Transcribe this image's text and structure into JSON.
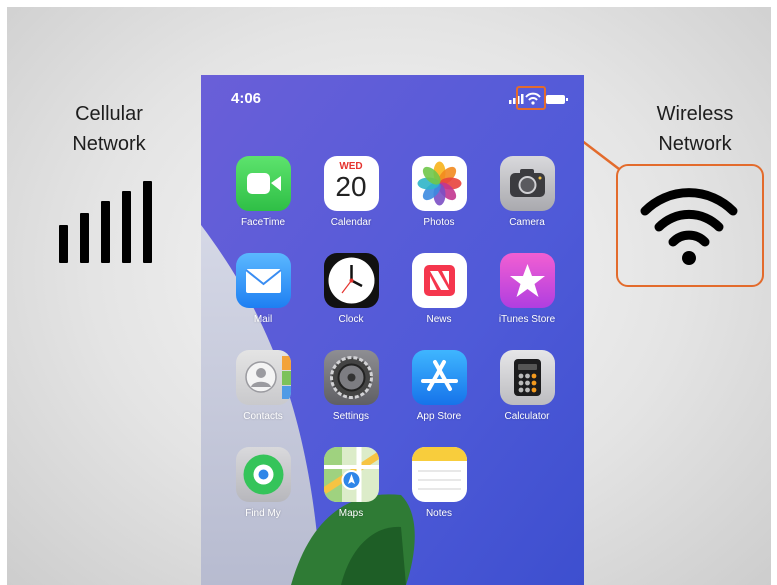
{
  "labels": {
    "cellular_line1": "Cellular",
    "cellular_line2": "Network",
    "wireless_line1": "Wireless",
    "wireless_line2": "Network"
  },
  "status_bar": {
    "time": "4:06"
  },
  "apps": [
    {
      "name": "FaceTime",
      "icon": "facetime-icon"
    },
    {
      "name": "Calendar",
      "icon": "calendar-icon",
      "day": "WED",
      "date": "20"
    },
    {
      "name": "Photos",
      "icon": "photos-icon"
    },
    {
      "name": "Camera",
      "icon": "camera-icon"
    },
    {
      "name": "Mail",
      "icon": "mail-icon"
    },
    {
      "name": "Clock",
      "icon": "clock-icon"
    },
    {
      "name": "News",
      "icon": "news-icon"
    },
    {
      "name": "iTunes Store",
      "icon": "itunes-store-icon"
    },
    {
      "name": "Contacts",
      "icon": "contacts-icon"
    },
    {
      "name": "Settings",
      "icon": "settings-icon"
    },
    {
      "name": "App Store",
      "icon": "app-store-icon"
    },
    {
      "name": "Calculator",
      "icon": "calculator-icon"
    },
    {
      "name": "Find My",
      "icon": "find-my-icon"
    },
    {
      "name": "Maps",
      "icon": "maps-icon"
    },
    {
      "name": "Notes",
      "icon": "notes-icon"
    }
  ],
  "colors": {
    "highlight": "#e36b2c",
    "wallpaper": "#5a55d6"
  }
}
